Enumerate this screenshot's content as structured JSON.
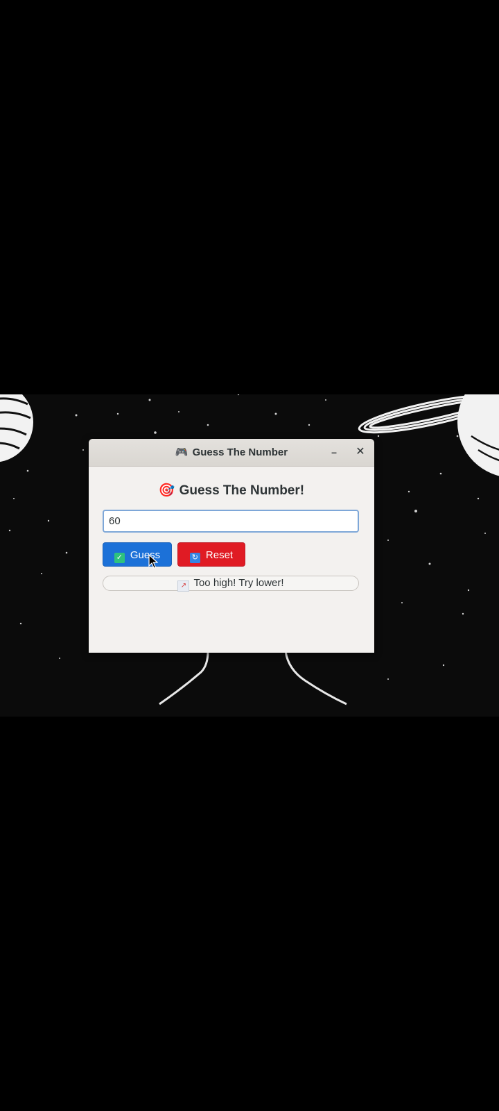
{
  "window": {
    "title": "Guess The Number",
    "title_icon": "gamepad-icon",
    "minimize_label": "–",
    "close_label": "✕"
  },
  "game": {
    "heading": "Guess The Number!",
    "heading_icon": "target-icon",
    "input_value": "60",
    "guess_label": "Guess",
    "guess_icon": "checkmark-icon",
    "reset_label": "Reset",
    "reset_icon": "refresh-icon",
    "status": "Too high! Try lower!",
    "status_icon": "chart-icon"
  },
  "colors": {
    "guess_button": "#1c71d8",
    "reset_button": "#e01b24",
    "input_border": "#7ea7d8"
  }
}
